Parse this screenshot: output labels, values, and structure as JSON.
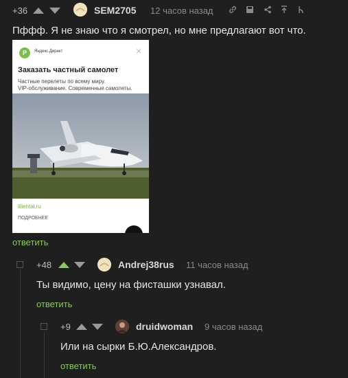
{
  "comment1": {
    "score": "+36",
    "user": "SEM2705",
    "time": "12 часов назад",
    "text": "Пффф. Я не знаю что я смотрел, но мне предлагают вот что.",
    "reply": "ответить"
  },
  "ad": {
    "brand": "Яндекс.Директ",
    "logo_letter": "P",
    "close": "×",
    "title": "Заказать частный самолет",
    "desc_line1": "Частные перелеты по всему миру.",
    "desc_line2": "VIP-обслуживание. Современные самолеты.",
    "domain": "liliental.ru",
    "more": "ПОДРОБНЕЕ"
  },
  "comment2": {
    "score": "+48",
    "user": "Andrej38rus",
    "time": "11 часов назад",
    "text": "Ты видимо, цену на фисташки узнавал.",
    "reply": "ответить"
  },
  "comment3": {
    "score": "+9",
    "user": "druidwoman",
    "time": "9 часов назад",
    "text": "Или на сырки Б.Ю.Александров.",
    "reply": "ответить"
  },
  "colors": {
    "accent_green": "#8ac858",
    "background": "#1f1f1f"
  },
  "icons": [
    "arrow-up-icon",
    "arrow-down-icon",
    "link-icon",
    "save-icon",
    "share-icon",
    "parent-icon",
    "branch-icon"
  ]
}
